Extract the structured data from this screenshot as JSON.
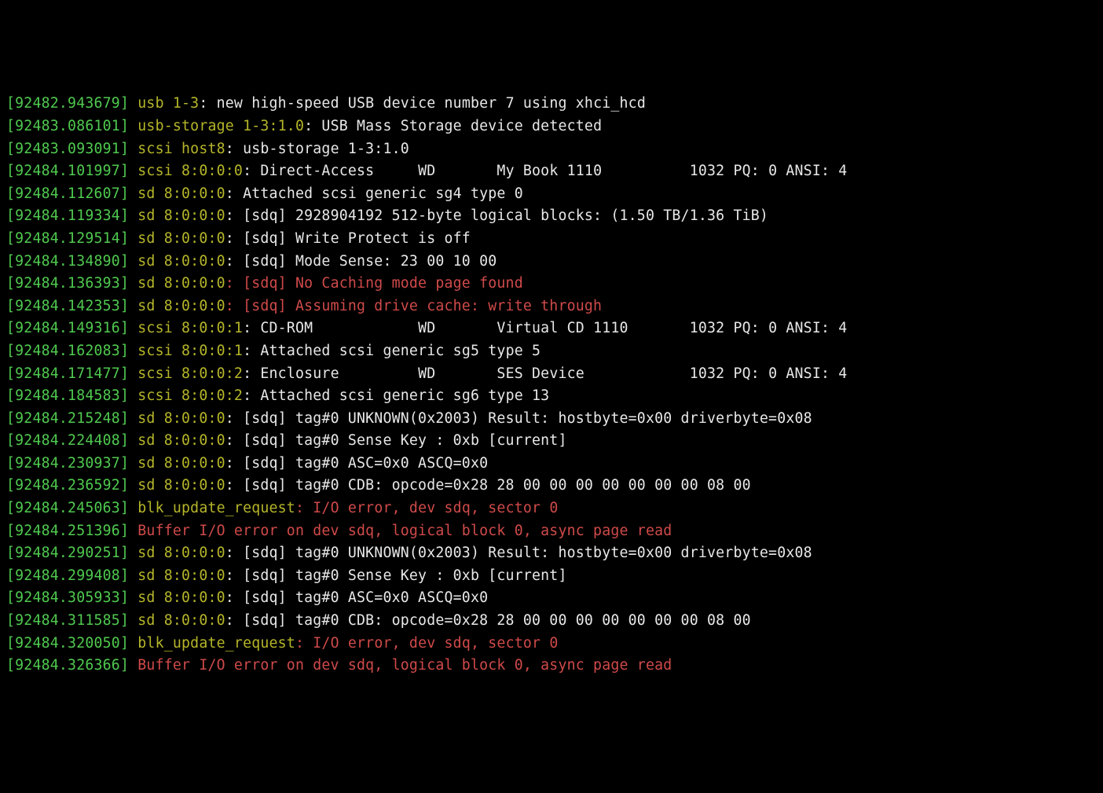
{
  "lines": [
    {
      "ts": "[92482.943679]",
      "src": "usb 1-3",
      "msg": ": new high-speed USB device number 7 using xhci_hcd",
      "style": "normal"
    },
    {
      "ts": "[92483.086101]",
      "src": "usb-storage 1-3:1.0",
      "msg": ": USB Mass Storage device detected",
      "style": "normal"
    },
    {
      "ts": "[92483.093091]",
      "src": "scsi host8",
      "msg": ": usb-storage 1-3:1.0",
      "style": "normal"
    },
    {
      "ts": "[92484.101997]",
      "src": "scsi 8:0:0:0",
      "msg": ": Direct-Access     WD       My Book 1110          1032 PQ: 0 ANSI: 4",
      "style": "normal"
    },
    {
      "ts": "[92484.112607]",
      "src": "sd 8:0:0:0",
      "msg": ": Attached scsi generic sg4 type 0",
      "style": "normal"
    },
    {
      "ts": "[92484.119334]",
      "src": "sd 8:0:0:0",
      "msg": ": [sdq] 2928904192 512-byte logical blocks: (1.50 TB/1.36 TiB)",
      "style": "normal"
    },
    {
      "ts": "[92484.129514]",
      "src": "sd 8:0:0:0",
      "msg": ": [sdq] Write Protect is off",
      "style": "normal"
    },
    {
      "ts": "[92484.134890]",
      "src": "sd 8:0:0:0",
      "msg": ": [sdq] Mode Sense: 23 00 10 00",
      "style": "normal"
    },
    {
      "ts": "[92484.136393]",
      "src": "sd 8:0:0:0",
      "msg": ": [sdq] No Caching mode page found",
      "style": "warn"
    },
    {
      "ts": "[92484.142353]",
      "src": "sd 8:0:0:0",
      "msg": ": [sdq] Assuming drive cache: write through",
      "style": "warn"
    },
    {
      "ts": "[92484.149316]",
      "src": "scsi 8:0:0:1",
      "msg": ": CD-ROM            WD       Virtual CD 1110       1032 PQ: 0 ANSI: 4",
      "style": "normal"
    },
    {
      "ts": "[92484.162083]",
      "src": "scsi 8:0:0:1",
      "msg": ": Attached scsi generic sg5 type 5",
      "style": "normal"
    },
    {
      "ts": "[92484.171477]",
      "src": "scsi 8:0:0:2",
      "msg": ": Enclosure         WD       SES Device            1032 PQ: 0 ANSI: 4",
      "style": "normal"
    },
    {
      "ts": "[92484.184583]",
      "src": "scsi 8:0:0:2",
      "msg": ": Attached scsi generic sg6 type 13",
      "style": "normal"
    },
    {
      "ts": "[92484.215248]",
      "src": "sd 8:0:0:0",
      "msg": ": [sdq] tag#0 UNKNOWN(0x2003) Result: hostbyte=0x00 driverbyte=0x08",
      "style": "normal"
    },
    {
      "ts": "[92484.224408]",
      "src": "sd 8:0:0:0",
      "msg": ": [sdq] tag#0 Sense Key : 0xb [current] ",
      "style": "normal"
    },
    {
      "ts": "[92484.230937]",
      "src": "sd 8:0:0:0",
      "msg": ": [sdq] tag#0 ASC=0x0 ASCQ=0x0",
      "style": "normal"
    },
    {
      "ts": "[92484.236592]",
      "src": "sd 8:0:0:0",
      "msg": ": [sdq] tag#0 CDB: opcode=0x28 28 00 00 00 00 00 00 00 08 00",
      "style": "normal"
    },
    {
      "ts": "[92484.245063]",
      "src": "blk_update_request",
      "msg": ": I/O error, dev sdq, sector 0",
      "style": "warn"
    },
    {
      "ts": "[92484.251396]",
      "src": "",
      "msg": "Buffer I/O error on dev sdq, logical block 0, async page read",
      "style": "err"
    },
    {
      "ts": "[92484.290251]",
      "src": "sd 8:0:0:0",
      "msg": ": [sdq] tag#0 UNKNOWN(0x2003) Result: hostbyte=0x00 driverbyte=0x08",
      "style": "normal"
    },
    {
      "ts": "[92484.299408]",
      "src": "sd 8:0:0:0",
      "msg": ": [sdq] tag#0 Sense Key : 0xb [current] ",
      "style": "normal"
    },
    {
      "ts": "[92484.305933]",
      "src": "sd 8:0:0:0",
      "msg": ": [sdq] tag#0 ASC=0x0 ASCQ=0x0",
      "style": "normal"
    },
    {
      "ts": "[92484.311585]",
      "src": "sd 8:0:0:0",
      "msg": ": [sdq] tag#0 CDB: opcode=0x28 28 00 00 00 00 00 00 00 08 00",
      "style": "normal"
    },
    {
      "ts": "[92484.320050]",
      "src": "blk_update_request",
      "msg": ": I/O error, dev sdq, sector 0",
      "style": "warn"
    },
    {
      "ts": "[92484.326366]",
      "src": "",
      "msg": "Buffer I/O error on dev sdq, logical block 0, async page read",
      "style": "err"
    }
  ]
}
